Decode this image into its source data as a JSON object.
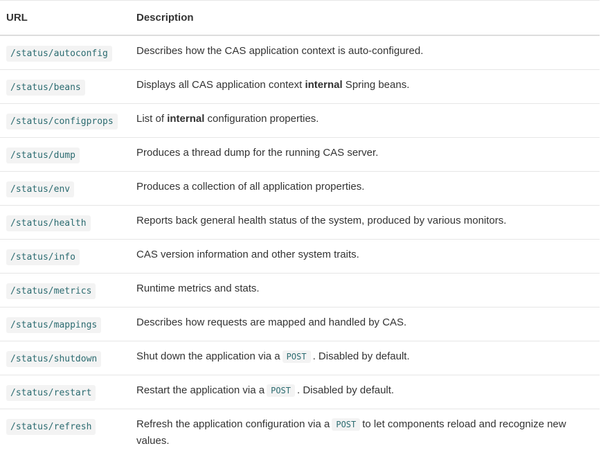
{
  "table": {
    "headers": {
      "url": "URL",
      "description": "Description"
    },
    "rows": [
      {
        "url": "/status/autoconfig",
        "desc": "Describes how the CAS application context is auto-configured."
      },
      {
        "url": "/status/beans",
        "desc_before": "Displays all CAS application context ",
        "desc_bold": "internal",
        "desc_after": " Spring beans."
      },
      {
        "url": "/status/configprops",
        "desc_before": "List of ",
        "desc_bold": "internal",
        "desc_after": " configuration properties."
      },
      {
        "url": "/status/dump",
        "desc": "Produces a thread dump for the running CAS server."
      },
      {
        "url": "/status/env",
        "desc": "Produces a collection of all application properties."
      },
      {
        "url": "/status/health",
        "desc": "Reports back general health status of the system, produced by various monitors."
      },
      {
        "url": "/status/info",
        "desc": "CAS version information and other system traits."
      },
      {
        "url": "/status/metrics",
        "desc": "Runtime metrics and stats."
      },
      {
        "url": "/status/mappings",
        "desc": "Describes how requests are mapped and handled by CAS."
      },
      {
        "url": "/status/shutdown",
        "desc_before": "Shut down the application via a",
        "desc_code": "POST",
        "desc_after": ". Disabled by default."
      },
      {
        "url": "/status/restart",
        "desc_before": "Restart the application via a",
        "desc_code": "POST",
        "desc_after": ". Disabled by default."
      },
      {
        "url": "/status/refresh",
        "desc_before": "Refresh the application configuration via a",
        "desc_code": "POST",
        "desc_after": "to let components reload and recognize new values."
      }
    ]
  }
}
